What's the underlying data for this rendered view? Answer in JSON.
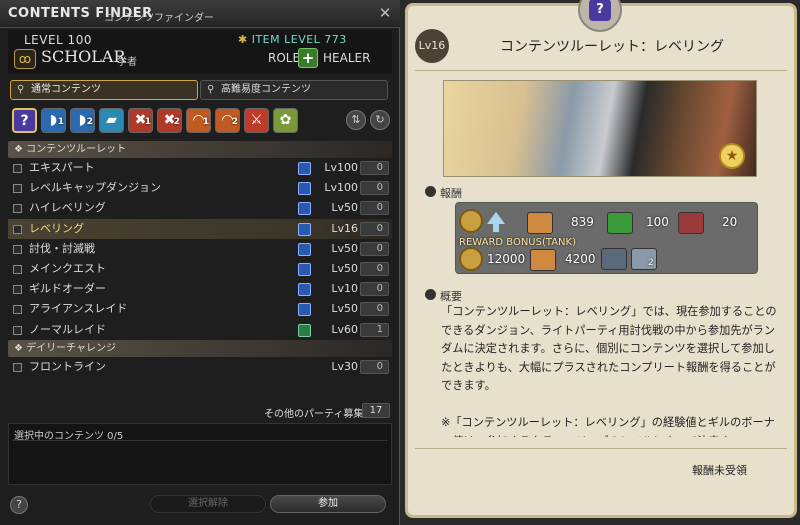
{
  "window": {
    "title": "CONTENTS FINDER",
    "subtitle": "コンテンツファインダー"
  },
  "job": {
    "level": "LEVEL 100",
    "item_level": "ITEM LEVEL 773",
    "name": "SCHOLAR",
    "name_jp": "学者",
    "role_label": "ROLE",
    "role": "HEALER"
  },
  "tabs": [
    {
      "label": "通常コンテンツ",
      "active": true
    },
    {
      "label": "高難易度コンテンツ",
      "active": false
    }
  ],
  "icon_bar": [
    {
      "icon": "roulette-icon",
      "num": "",
      "color": "#4a3aa0"
    },
    {
      "icon": "dungeon-icon",
      "num": "1",
      "color": "#2a6ab0"
    },
    {
      "icon": "dungeon-icon",
      "num": "2",
      "color": "#2a6ab0"
    },
    {
      "icon": "guildhest-icon",
      "num": "",
      "color": "#2a8ab0"
    },
    {
      "icon": "trial-icon",
      "num": "1",
      "color": "#b03a2a"
    },
    {
      "icon": "trial-icon",
      "num": "2",
      "color": "#b03a2a"
    },
    {
      "icon": "raid-icon",
      "num": "1",
      "color": "#c05a20"
    },
    {
      "icon": "raid-icon",
      "num": "2",
      "color": "#c05a20"
    },
    {
      "icon": "pvp-icon",
      "num": "",
      "color": "#c03a2a"
    },
    {
      "icon": "gold-saucer-icon",
      "num": "",
      "color": "#7a9a3a"
    }
  ],
  "sections": [
    {
      "title": "コンテンツルーレット",
      "rows": [
        {
          "name": "エキスパート",
          "level": "Lv100",
          "count": "0",
          "highlight": false,
          "icon": "blue"
        },
        {
          "name": "レベルキャップダンジョン",
          "level": "Lv100",
          "count": "0",
          "highlight": false,
          "icon": "blue"
        },
        {
          "name": "ハイレベリング",
          "level": "Lv50",
          "count": "0",
          "highlight": false,
          "icon": "blue"
        },
        {
          "name": "レベリング",
          "level": "Lv16",
          "count": "0",
          "highlight": true,
          "icon": "blue"
        },
        {
          "name": "討伐・討滅戦",
          "level": "Lv50",
          "count": "0",
          "highlight": false,
          "icon": "blue"
        },
        {
          "name": "メインクエスト",
          "level": "Lv50",
          "count": "0",
          "highlight": false,
          "icon": "blue"
        },
        {
          "name": "ギルドオーダー",
          "level": "Lv10",
          "count": "0",
          "highlight": false,
          "icon": "blue"
        },
        {
          "name": "アライアンスレイド",
          "level": "Lv50",
          "count": "0",
          "highlight": false,
          "icon": "blue"
        },
        {
          "name": "ノーマルレイド",
          "level": "Lv60",
          "count": "1",
          "highlight": false,
          "icon": "green"
        }
      ]
    },
    {
      "title": "デイリーチャレンジ",
      "rows": [
        {
          "name": "フロントライン",
          "level": "Lv30",
          "count": "0",
          "highlight": false,
          "icon": ""
        }
      ]
    }
  ],
  "party": {
    "label": "その他のパーティ募集",
    "count": "17"
  },
  "selected": {
    "label": "選択中のコンテンツ 0/5"
  },
  "buttons": {
    "help": "?",
    "clear": "選択解除",
    "join": "参加"
  },
  "detail": {
    "level_badge": "Lv16",
    "title": "コンテンツルーレット：レベリング",
    "reward_label": "報酬",
    "rewards_row1": [
      {
        "icon": "gil-icon"
      },
      {
        "icon": "bonus-arrow-icon"
      },
      {
        "icon": "exp-icon",
        "value": "839"
      },
      {
        "icon": "tomestone-green-icon",
        "value": "100"
      },
      {
        "icon": "tomestone-red-icon",
        "value": "20"
      }
    ],
    "reward_bonus": "REWARD BONUS(TANK)",
    "rewards_row2": [
      {
        "icon": "gil-icon",
        "value": "12000"
      },
      {
        "icon": "exp-icon",
        "value": "4200"
      },
      {
        "icon": "seal-icon"
      },
      {
        "icon": "crystal-icon",
        "value": "2"
      }
    ],
    "overview_label": "概要",
    "description": "「コンテンツルーレット：レベリング」では、現在参加することのできるダンジョン、ライトパーティ用討伐戦の中から参加先がランダムに決定されます。さらに、個別にコンテンツを選択して参加したときよりも、大幅にプラスされたコンプリート報酬を得ることができます。\n\n※「コンテンツルーレット：レベリング」の経験値とギルのボーナス値は、参加するクラス・ジョブのレベルによって決定さ",
    "status": "報酬未受領"
  }
}
